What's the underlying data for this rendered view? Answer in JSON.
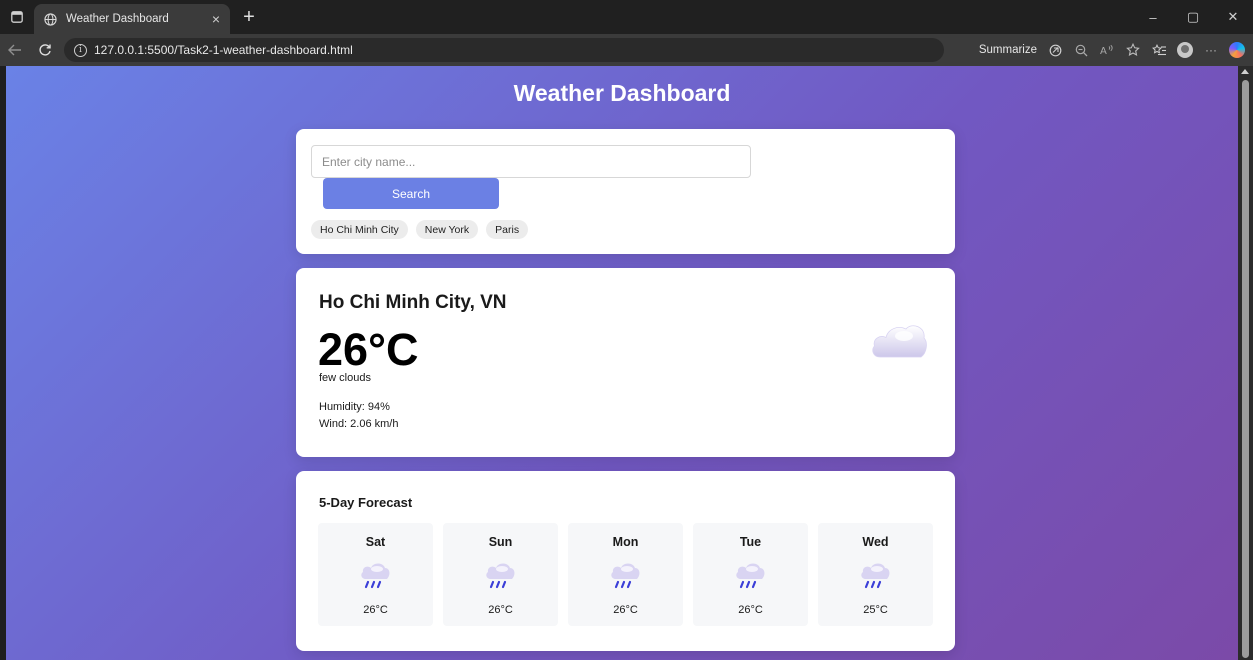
{
  "browser": {
    "tab_title": "Weather Dashboard",
    "tab_close": "×",
    "new_tab": "+",
    "url": "127.0.0.1:5500/Task2-1-weather-dashboard.html",
    "summarize_label": "Summarize",
    "more_label": "···",
    "window": {
      "minimize": "–",
      "restore": "▢",
      "close": "✕"
    }
  },
  "page": {
    "title": "Weather Dashboard"
  },
  "search": {
    "placeholder": "Enter city name...",
    "button_label": "Search",
    "quick_cities": [
      "Ho Chi Minh City",
      "New York",
      "Paris"
    ]
  },
  "current": {
    "location": "Ho Chi Minh City, VN",
    "temperature": "26°C",
    "condition": "few clouds",
    "humidity": "Humidity: 94%",
    "wind": "Wind: 2.06 km/h",
    "icon": "cloud-icon"
  },
  "forecast": {
    "title": "5-Day Forecast",
    "days": [
      {
        "day": "Sat",
        "temp": "26°C",
        "icon": "rain-cloud-icon"
      },
      {
        "day": "Sun",
        "temp": "26°C",
        "icon": "rain-cloud-icon"
      },
      {
        "day": "Mon",
        "temp": "26°C",
        "icon": "rain-cloud-icon"
      },
      {
        "day": "Tue",
        "temp": "26°C",
        "icon": "rain-cloud-icon"
      },
      {
        "day": "Wed",
        "temp": "25°C",
        "icon": "rain-cloud-icon"
      }
    ]
  },
  "colors": {
    "accent": "#6b80e4",
    "gradient_start": "#6a82e6",
    "gradient_end": "#7b4aa8"
  }
}
